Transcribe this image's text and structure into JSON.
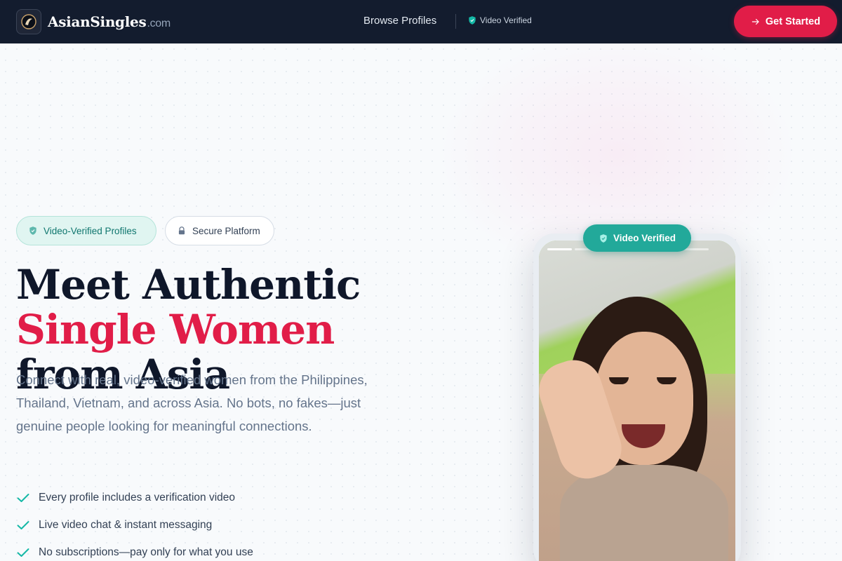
{
  "header": {
    "brand": "AsianSingles",
    "brand_tld": ".com",
    "nav_browse": "Browse Profiles",
    "nav_verified": "Video Verified",
    "cta": "Get Started"
  },
  "hero": {
    "badges": [
      "Video-Verified Profiles",
      "Secure Platform"
    ],
    "headline_part1": "Meet Authentic ",
    "headline_accent": "Single Women",
    "headline_part2": " from Asia",
    "description": "Connect with real, video-verified women from the Philippines, Thailand, Vietnam, and across Asia. No bots, no fakes—just genuine people looking for meaningful connections.",
    "features": [
      "Every profile includes a verification video",
      "Live video chat & instant messaging",
      "No subscriptions—pay only for what you use"
    ]
  },
  "video_card": {
    "pill": "Video Verified",
    "progress_segments": 6,
    "progress_active": 1
  },
  "colors": {
    "header_bg": "#131c2e",
    "accent": "#e11d48",
    "teal": "#22a99a"
  }
}
